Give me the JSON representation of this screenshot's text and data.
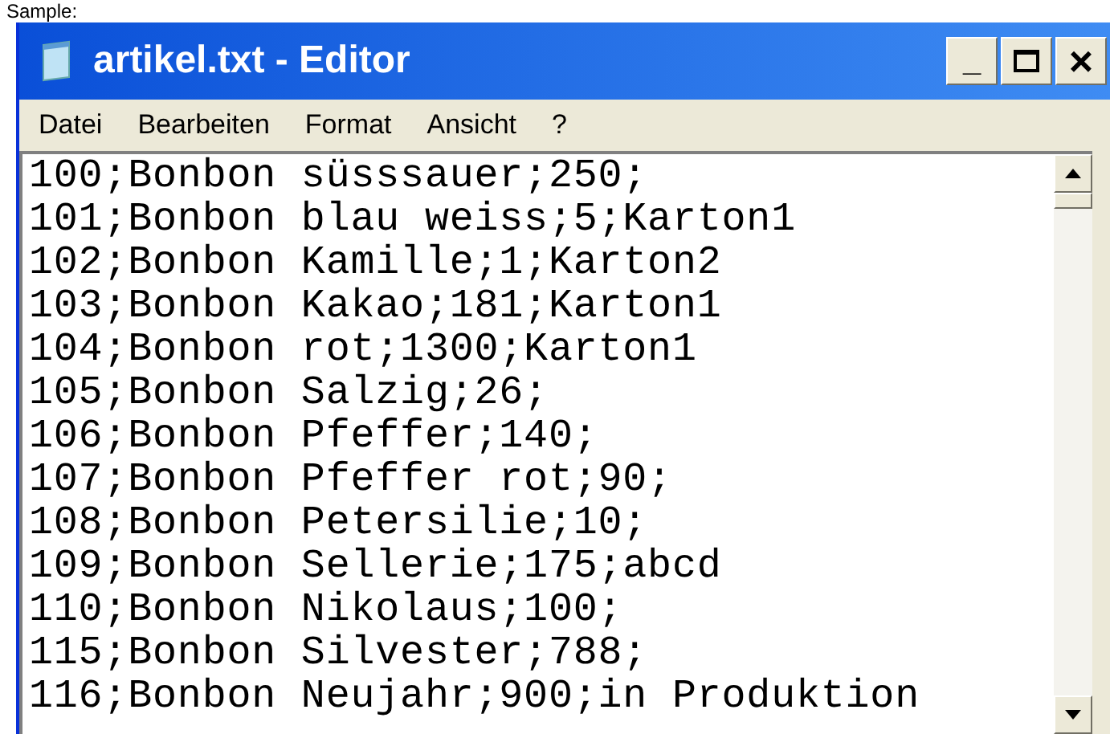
{
  "caption": "Sample:",
  "window": {
    "title": "artikel.txt - Editor",
    "controls": [
      {
        "kind": "minimize",
        "label": "_"
      },
      {
        "kind": "maximize"
      },
      {
        "kind": "close",
        "label": "×"
      }
    ]
  },
  "menu": [
    "Datei",
    "Bearbeiten",
    "Format",
    "Ansicht",
    "?"
  ],
  "lines": [
    "100;Bonbon süsssauer;250;",
    "101;Bonbon blau weiss;5;Karton1",
    "102;Bonbon Kamille;1;Karton2",
    "103;Bonbon Kakao;181;Karton1",
    "104;Bonbon rot;1300;Karton1",
    "105;Bonbon Salzig;26;",
    "106;Bonbon Pfeffer;140;",
    "107;Bonbon Pfeffer rot;90;",
    "108;Bonbon Petersilie;10;",
    "109;Bonbon Sellerie;175;abcd",
    "110;Bonbon Nikolaus;100;",
    "115;Bonbon Silvester;788;",
    "116;Bonbon Neujahr;900;in Produktion"
  ]
}
